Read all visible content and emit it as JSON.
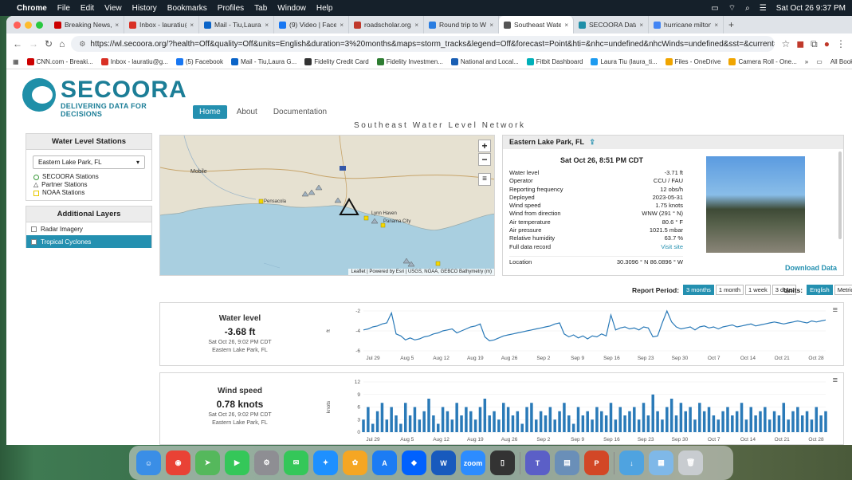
{
  "menubar": {
    "app": "Chrome",
    "items": [
      "File",
      "Edit",
      "View",
      "History",
      "Bookmarks",
      "Profiles",
      "Tab",
      "Window",
      "Help"
    ],
    "clock": "Sat Oct 26  9:37 PM"
  },
  "tabs": [
    {
      "label": "Breaking News, Late",
      "color": "#cc0000"
    },
    {
      "label": "Inbox - lauratiu@gm",
      "color": "#d93025"
    },
    {
      "label": "Mail - Tiu,Laura G -",
      "color": "#0a64c8"
    },
    {
      "label": "(9) Video | Facebook",
      "color": "#1877f2"
    },
    {
      "label": "roadscholar.org/che",
      "color": "#c0392b"
    },
    {
      "label": "Round trip to Washi",
      "color": "#2a7de1"
    },
    {
      "label": "Southeast Water Le",
      "color": "#555555"
    },
    {
      "label": "SECOORA Data Port",
      "color": "#1f8fa8"
    },
    {
      "label": "hurricane milton hit",
      "color": "#4285f4"
    }
  ],
  "url": "https://wl.secoora.org/?health=Off&quality=Off&units=English&duration=3%20months&maps=storm_tracks&legend=Off&forecast=Point&hti=&nhc=undefined&nhcWinds=undefined&sst=&current=&datum=MLLW&windPredi...",
  "bookmarks": [
    {
      "label": "CNN.com - Breaki...",
      "color": "#cc0000"
    },
    {
      "label": "Inbox - lauratiu@g...",
      "color": "#d93025"
    },
    {
      "label": "(5) Facebook",
      "color": "#1877f2"
    },
    {
      "label": "Mail - Tiu,Laura G...",
      "color": "#0a64c8"
    },
    {
      "label": "Fidelity Credit Card",
      "color": "#333333"
    },
    {
      "label": "Fidelity Investmen...",
      "color": "#2e7d32"
    },
    {
      "label": "National and Local...",
      "color": "#1a5fb4"
    },
    {
      "label": "Fitbit Dashboard",
      "color": "#00b0b9"
    },
    {
      "label": "Laura Tiu (laura_ti...",
      "color": "#1d9bf0"
    },
    {
      "label": "Files - OneDrive",
      "color": "#f0a500"
    },
    {
      "label": "Camera Roll - One...",
      "color": "#f0a500"
    }
  ],
  "bookmarks_all": "All Bookmarks",
  "site": {
    "logo_name": "SECOORA",
    "logo_tagline": "DELIVERING DATA FOR DECISIONS",
    "nav": [
      "Home",
      "About",
      "Documentation"
    ],
    "network_title": "Southeast Water Level Network"
  },
  "stations_panel": {
    "title": "Water Level Stations",
    "selected": "Eastern Lake Park, FL",
    "legend": [
      {
        "label": "SECOORA Stations",
        "shape": "circle",
        "color": "#3c9a3c"
      },
      {
        "label": "Partner Stations",
        "shape": "triangle",
        "color": "#333333"
      },
      {
        "label": "NOAA Stations",
        "shape": "square",
        "color": "#e6c800"
      }
    ]
  },
  "layers_panel": {
    "title": "Additional Layers",
    "items": [
      {
        "label": "Radar Imagery",
        "checked": false
      },
      {
        "label": "Tropical Cyclones",
        "checked": true
      }
    ]
  },
  "map": {
    "cities": [
      "Mobile",
      "Pensacola",
      "Lynn Haven",
      "Panama City"
    ],
    "zoom_in": "+",
    "zoom_out": "−",
    "layers_icon": "≡",
    "attribution": "Leaflet | Powered by Esri | USGS, NOAA, GEBCO Bathymetry (m)"
  },
  "station_info": {
    "title": "Eastern Lake Park, FL",
    "date": "Sat Oct 26, 8:51 PM CDT",
    "rows": [
      {
        "label": "Water level",
        "value": "-3.71 ft"
      },
      {
        "label": "Operator",
        "value": "CCU / FAU"
      },
      {
        "label": "Reporting frequency",
        "value": "12 obs/h"
      },
      {
        "label": "Deployed",
        "value": "2023-05-31"
      },
      {
        "label": "Wind speed",
        "value": "1.75 knots"
      },
      {
        "label": "Wind from direction",
        "value": "WNW (291 ° N)"
      },
      {
        "label": "Air temperature",
        "value": "80.6 ° F"
      },
      {
        "label": "Air pressure",
        "value": "1021.5 mbar"
      },
      {
        "label": "Relative humidity",
        "value": "63.7 %"
      },
      {
        "label": "Full data record",
        "value": "Visit site"
      }
    ],
    "location_label": "Location",
    "location_value": "30.3096 ° N 86.0896 ° W",
    "download": "Download Data"
  },
  "report": {
    "label": "Report Period:",
    "options": [
      "3 months",
      "1 month",
      "1 week",
      "3 days"
    ],
    "selected": "3 months"
  },
  "units": {
    "label": "Units:",
    "options": [
      "English",
      "Metric"
    ],
    "selected": "English"
  },
  "water_panel": {
    "title": "Water level",
    "value": "-3.68 ft",
    "time": "Sat Oct 26, 9:02 PM CDT",
    "station": "Eastern Lake Park, FL",
    "menu": "≡"
  },
  "wind_panel": {
    "title": "Wind speed",
    "value": "0.78 knots",
    "time": "Sat Oct 26, 9:02 PM CDT",
    "station": "Eastern Lake Park, FL",
    "menu": "≡"
  },
  "chart_data": [
    {
      "type": "line",
      "ylabel": "ft",
      "ylim": [
        -6,
        -2
      ],
      "yticks": [
        -2,
        -4,
        -6
      ],
      "xticks": [
        "Jul 29",
        "Aug 5",
        "Aug 12",
        "Aug 19",
        "Aug 26",
        "Sep 2",
        "Sep 9",
        "Sep 16",
        "Sep 23",
        "Sep 30",
        "Oct 7",
        "Oct 14",
        "Oct 21",
        "Oct 28"
      ],
      "series": [
        {
          "color": "#2a7ab8",
          "values": [
            -3.9,
            -3.8,
            -3.6,
            -3.5,
            -3.3,
            -3.2,
            -2.2,
            -4.3,
            -4.5,
            -4.9,
            -4.7,
            -4.9,
            -4.8,
            -4.6,
            -4.5,
            -4.3,
            -4.2,
            -4.0,
            -3.9,
            -3.8,
            -4.2,
            -4.0,
            -3.8,
            -3.6,
            -3.5,
            -3.3,
            -4.6,
            -5.0,
            -4.9,
            -4.7,
            -4.5,
            -4.4,
            -4.3,
            -4.2,
            -4.1,
            -4.0,
            -3.9,
            -3.8,
            -3.7,
            -3.6,
            -3.5,
            -3.3,
            -3.2,
            -4.3,
            -4.6,
            -4.4,
            -4.7,
            -4.5,
            -4.8,
            -4.5,
            -4.6,
            -4.3,
            -4.5,
            -2.4,
            -3.9,
            -3.7,
            -3.6,
            -3.8,
            -3.7,
            -3.9,
            -3.6,
            -3.7,
            -4.6,
            -4.5,
            -3.2,
            -2.0,
            -3.1,
            -3.6,
            -3.8,
            -3.7,
            -3.6,
            -3.9,
            -3.6,
            -3.5,
            -3.7,
            -3.6,
            -3.8,
            -3.6,
            -3.5,
            -3.4,
            -3.6,
            -3.5,
            -3.4,
            -3.3,
            -3.5,
            -3.4,
            -3.3,
            -3.2,
            -3.1,
            -3.2,
            -3.3,
            -3.2,
            -3.1,
            -3.0,
            -3.1,
            -3.2,
            -3.0,
            -3.1,
            -3.0,
            -2.9
          ]
        }
      ]
    },
    {
      "type": "area",
      "ylabel": "knots",
      "ylim": [
        0,
        12
      ],
      "yticks": [
        12,
        9,
        6,
        3,
        0
      ],
      "xticks": [
        "Jul 29",
        "Aug 5",
        "Aug 12",
        "Aug 19",
        "Aug 26",
        "Sep 2",
        "Sep 9",
        "Sep 16",
        "Sep 23",
        "Sep 30",
        "Oct 7",
        "Oct 14",
        "Oct 21",
        "Oct 28"
      ],
      "series": [
        {
          "color": "#2a7ab8",
          "values": [
            3,
            6,
            2,
            5,
            7,
            3,
            6,
            4,
            2,
            7,
            4,
            6,
            3,
            5,
            8,
            4,
            2,
            6,
            5,
            3,
            7,
            4,
            6,
            5,
            3,
            6,
            8,
            4,
            5,
            3,
            7,
            6,
            4,
            5,
            2,
            6,
            7,
            3,
            5,
            4,
            6,
            3,
            5,
            7,
            4,
            2,
            6,
            4,
            5,
            3,
            6,
            5,
            4,
            7,
            3,
            6,
            4,
            5,
            6,
            3,
            7,
            4,
            9,
            5,
            3,
            6,
            8,
            4,
            7,
            5,
            6,
            3,
            7,
            5,
            6,
            4,
            3,
            5,
            6,
            4,
            5,
            7,
            3,
            6,
            4,
            5,
            6,
            3,
            5,
            4,
            7,
            3,
            5,
            6,
            4,
            5,
            3,
            6,
            4,
            5
          ]
        }
      ]
    }
  ],
  "dock": [
    {
      "name": "finder",
      "color": "#3a8ee6",
      "glyph": "☺"
    },
    {
      "name": "chrome",
      "color": "#e94235",
      "glyph": "◉"
    },
    {
      "name": "maps",
      "color": "#55b85c",
      "glyph": "➤"
    },
    {
      "name": "facetime",
      "color": "#34c759",
      "glyph": "▶"
    },
    {
      "name": "system-settings",
      "color": "#8e8e93",
      "glyph": "⚙"
    },
    {
      "name": "messages",
      "color": "#34c759",
      "glyph": "✉"
    },
    {
      "name": "safari",
      "color": "#1e90ff",
      "glyph": "✦"
    },
    {
      "name": "photos",
      "color": "#f5a623",
      "glyph": "✿"
    },
    {
      "name": "app-store",
      "color": "#1c7cf4",
      "glyph": "A"
    },
    {
      "name": "dropbox",
      "color": "#0061fe",
      "glyph": "◆"
    },
    {
      "name": "word",
      "color": "#185abd",
      "glyph": "W"
    },
    {
      "name": "zoom",
      "color": "#2d8cff",
      "glyph": "zoom"
    },
    {
      "name": "iphone-mirroring",
      "color": "#333333",
      "glyph": "▯"
    },
    {
      "name": "teams",
      "color": "#5b5fc7",
      "glyph": "T"
    },
    {
      "name": "preview",
      "color": "#6a8fb8",
      "glyph": "▤"
    },
    {
      "name": "powerpoint",
      "color": "#d24726",
      "glyph": "P"
    },
    {
      "name": "downloads",
      "color": "#4fa3e0",
      "glyph": "↓"
    },
    {
      "name": "documents",
      "color": "#7fb8e8",
      "glyph": "▦"
    },
    {
      "name": "trash",
      "color": "#c8ccd0",
      "glyph": "🗑"
    }
  ]
}
